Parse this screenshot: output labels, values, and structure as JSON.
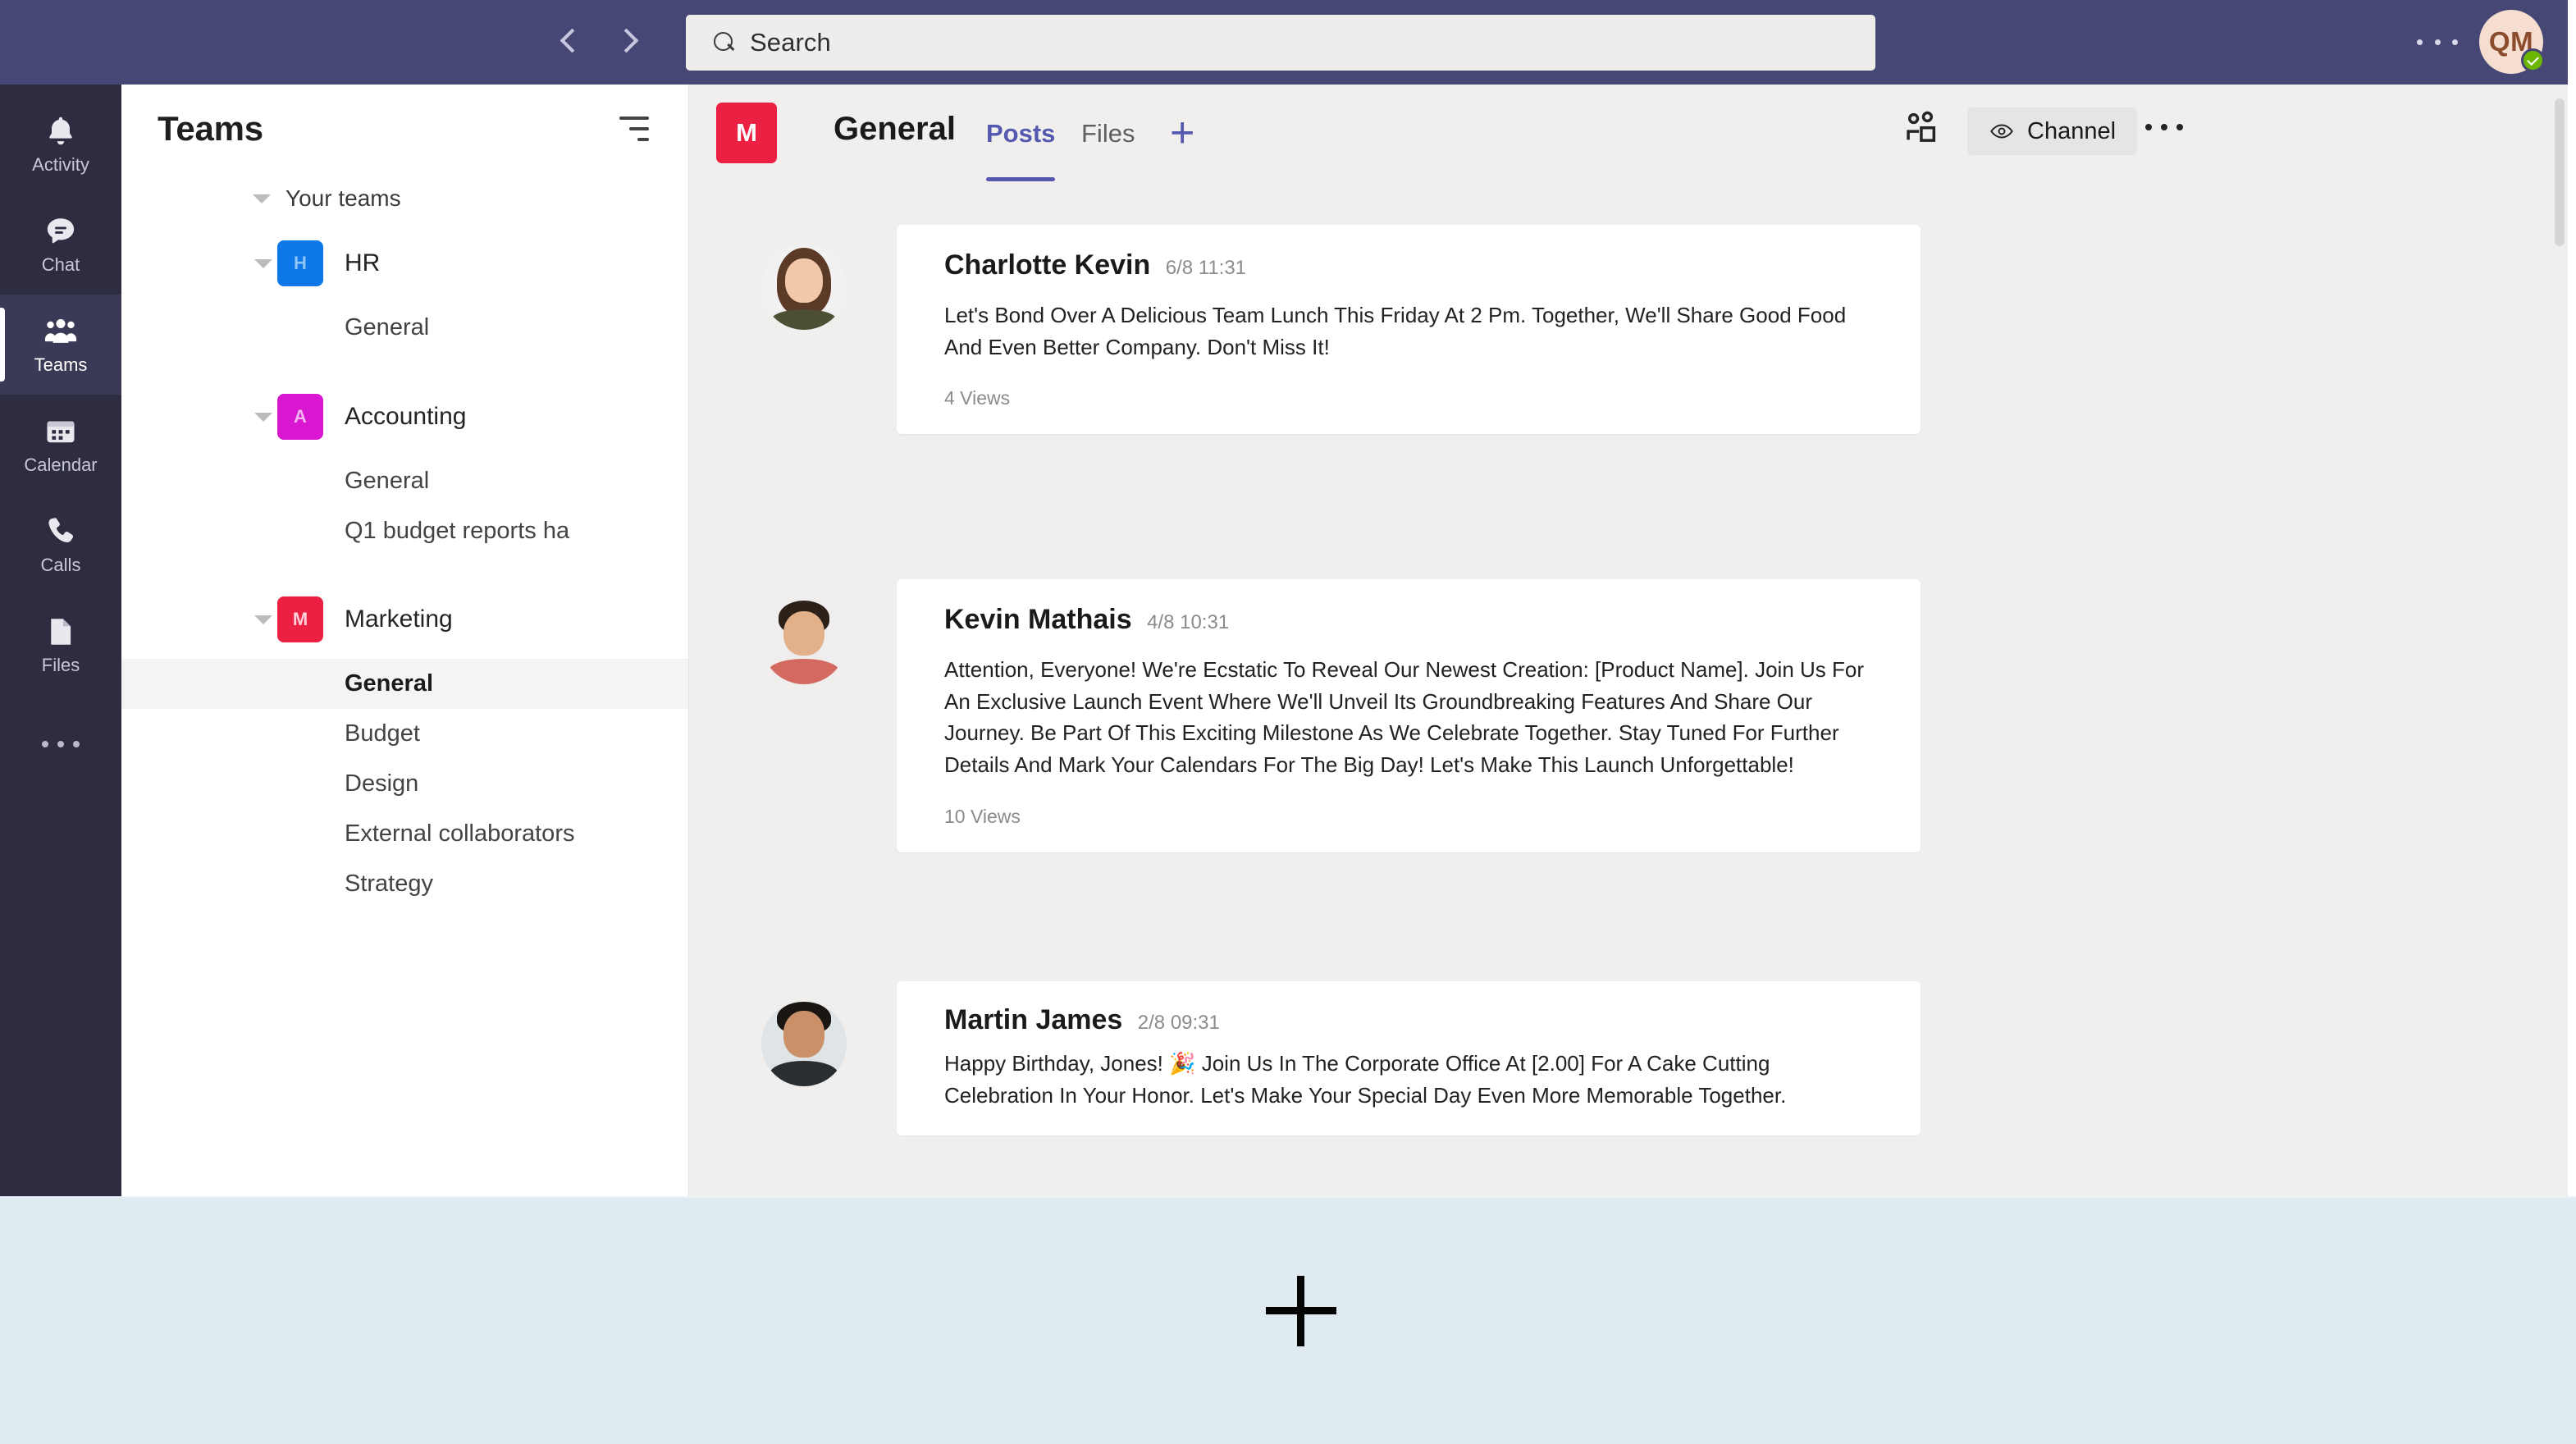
{
  "topbar": {
    "back_icon": "chevron-left-icon",
    "forward_icon": "chevron-right-icon",
    "search": {
      "placeholder": "Search",
      "value": "",
      "icon": "search-icon"
    },
    "more_label": "…",
    "avatar": {
      "initials": "QM",
      "presence": "available",
      "bg": "#f5ddd0",
      "fg": "#8a4c2c",
      "presence_color": "#6bb700"
    }
  },
  "rail": {
    "items": [
      {
        "label": "Activity",
        "icon": "bell-icon",
        "active": false
      },
      {
        "label": "Chat",
        "icon": "chat-bubble-icon",
        "active": false
      },
      {
        "label": "Teams",
        "icon": "people-icon",
        "active": true
      },
      {
        "label": "Calendar",
        "icon": "calendar-icon",
        "active": false
      },
      {
        "label": "Calls",
        "icon": "phone-icon",
        "active": false
      },
      {
        "label": "Files",
        "icon": "file-icon",
        "active": false
      }
    ],
    "more_label": "…"
  },
  "sidebar": {
    "title": "Teams",
    "filter_icon": "filter-icon",
    "section_label": "Your teams",
    "teams": [
      {
        "name": "HR",
        "initial": "H",
        "color": "#0f78e8",
        "initial_color": "#8ec5f7",
        "overflow_label": "…",
        "channels": [
          {
            "name": "General",
            "selected": false
          }
        ]
      },
      {
        "name": "Accounting",
        "initial": "A",
        "color": "#d916d0",
        "initial_color": "#f7b4f4",
        "overflow_label": "…",
        "channels": [
          {
            "name": "General",
            "selected": false
          },
          {
            "name": "Q1 budget reports ha",
            "selected": false
          }
        ]
      },
      {
        "name": "Marketing",
        "initial": "M",
        "color": "#eb2043",
        "initial_color": "#ffd2dc",
        "overflow_label": "…",
        "channels": [
          {
            "name": "General",
            "selected": true
          },
          {
            "name": "Budget",
            "selected": false
          },
          {
            "name": "Design",
            "selected": false
          },
          {
            "name": "External collaborators",
            "selected": false
          },
          {
            "name": "Strategy",
            "selected": false
          }
        ]
      }
    ]
  },
  "channel_header": {
    "team_initial": "M",
    "team_color": "#eb2043",
    "title": "General",
    "tabs": [
      {
        "label": "Posts",
        "active": true
      },
      {
        "label": "Files",
        "active": false
      }
    ],
    "add_tab_label": "+",
    "members_icon": "people-group-icon",
    "channel_button": {
      "label": "Channel",
      "icon": "eye-icon"
    },
    "more_label": "…",
    "accent": "#5558af"
  },
  "posts": [
    {
      "author": "Charlotte Kevin",
      "timestamp": "6/8 11:31",
      "body": "Let's Bond Over A Delicious Team Lunch This Friday At 2 Pm. Together, We'll Share Good Food And Even Better Company. Don't Miss It!",
      "views": "4 Views",
      "avatar": "charlotte-kevin-avatar"
    },
    {
      "author": "Kevin Mathais",
      "timestamp": "4/8 10:31",
      "body": "Attention, Everyone! We're Ecstatic To Reveal Our Newest Creation: [Product Name]. Join Us For An Exclusive Launch Event Where We'll Unveil Its Groundbreaking Features And Share Our Journey. Be Part Of This Exciting Milestone As We Celebrate Together. Stay Tuned For Further Details And Mark Your Calendars For The Big Day! Let's Make This Launch Unforgettable!",
      "views": "10 Views",
      "avatar": "kevin-mathais-avatar"
    },
    {
      "author": "Martin James",
      "timestamp": "2/8 09:31",
      "body": "Happy Birthday, Jones! 🎉 Join Us In The Corporate Office At [2.00] For A Cake Cutting Celebration In Your Honor. Let's Make Your Special Day Even More Memorable Together.",
      "views": "",
      "avatar": "martin-james-avatar"
    }
  ],
  "overlay": {
    "background": "#dfeaf1",
    "cursor_icon": "plus-crosshair-cursor"
  }
}
